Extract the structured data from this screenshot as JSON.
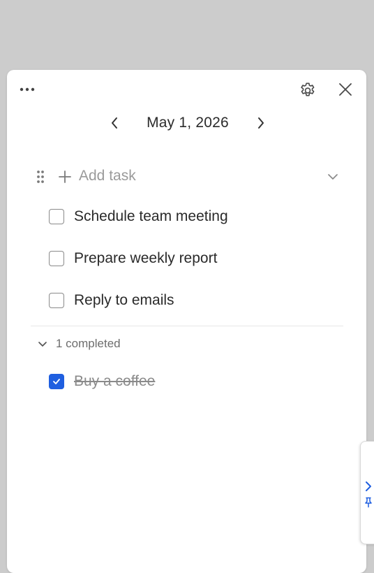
{
  "toolbar": {
    "more_icon": "more-horizontal-icon",
    "settings_icon": "gear-icon",
    "close_icon": "close-icon"
  },
  "date_nav": {
    "prev_icon": "chevron-left-icon",
    "date": "May 1, 2026",
    "next_icon": "chevron-right-icon"
  },
  "add_task": {
    "label": "Add task",
    "drag_icon": "drag-handle-icon",
    "plus_icon": "plus-icon",
    "collapse_icon": "chevron-down-icon"
  },
  "tasks": [
    {
      "label": "Schedule team meeting",
      "checked": false
    },
    {
      "label": "Prepare weekly report",
      "checked": false
    },
    {
      "label": "Reply to emails",
      "checked": false
    }
  ],
  "completed": {
    "label": "1 completed",
    "expanded": true,
    "items": [
      {
        "label": "Buy a coffee",
        "checked": true
      }
    ]
  },
  "side_tab": {
    "expand_icon": "chevron-right-icon",
    "pin_icon": "pin-icon"
  },
  "colors": {
    "accent": "#1f5fe0",
    "background": "#cccccc",
    "panel": "#ffffff"
  }
}
